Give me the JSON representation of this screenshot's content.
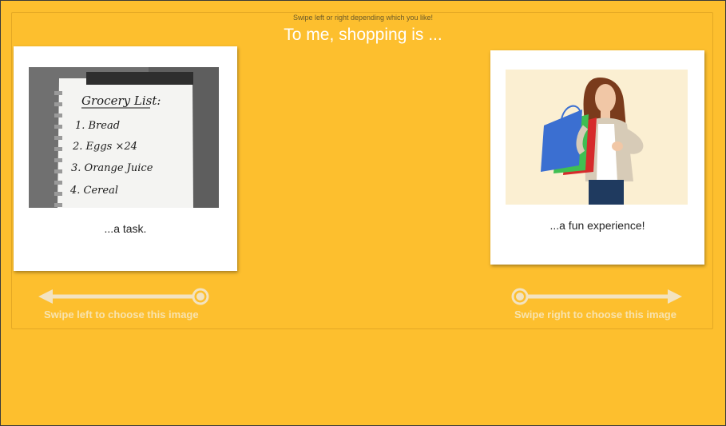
{
  "header": {
    "hint": "Swipe left or right depending which you like!",
    "title": "To me, shopping is ..."
  },
  "cards": [
    {
      "caption": "...a task."
    },
    {
      "caption": "...a fun experience!"
    }
  ],
  "grocery_list": {
    "heading": "Grocery List:",
    "items": [
      "1. Bread",
      "2. Eggs ×24",
      "3. Orange Juice",
      "4. Cereal"
    ]
  },
  "swipe": {
    "left_label": "Swipe left to choose this image",
    "right_label": "Swipe right to choose this image"
  },
  "colors": {
    "background": "#FDBF2E",
    "swipe_indicator": "#F3E3C0",
    "title_text": "#FFFFFF"
  }
}
